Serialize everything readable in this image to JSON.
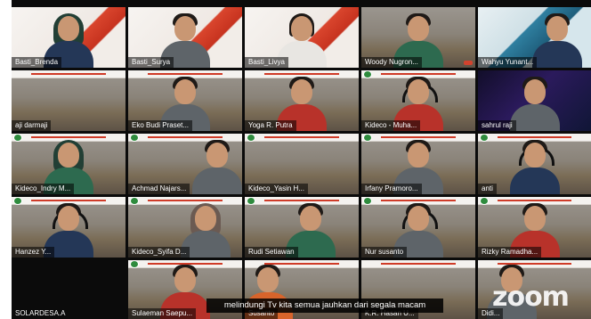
{
  "meeting": {
    "app": "zoom",
    "active_speaker": "Woody Nugron...",
    "caption": "melindungi Tv kita semua jauhkan dari segala macam"
  },
  "participants": [
    {
      "name": "Basti_Brenda",
      "bg": "red",
      "avatar": "hijab"
    },
    {
      "name": "Basti_Surya",
      "bg": "red",
      "avatar": "person"
    },
    {
      "name": "Basti_Livya",
      "bg": "red",
      "avatar": "person"
    },
    {
      "name": "Woody Nugron...",
      "bg": "quarry",
      "avatar": "person"
    },
    {
      "name": "Wahyu Yunant...",
      "bg": "blue",
      "avatar": "person"
    },
    {
      "name": "aji darmaji",
      "bg": "quarry",
      "avatar": "none"
    },
    {
      "name": "Eko Budi Praset...",
      "bg": "quarry",
      "avatar": "person"
    },
    {
      "name": "Yoga R. Putra",
      "bg": "quarry",
      "avatar": "person"
    },
    {
      "name": "Kideco - Muha...",
      "bg": "quarry",
      "avatar": "headset"
    },
    {
      "name": "sahrul raji",
      "bg": "dark",
      "avatar": "person"
    },
    {
      "name": "Kideco_Indry M...",
      "bg": "quarry",
      "avatar": "hijab"
    },
    {
      "name": "Achmad Najars...",
      "bg": "quarry",
      "avatar": "person"
    },
    {
      "name": "Kideco_Yasin H...",
      "bg": "quarry",
      "avatar": "none"
    },
    {
      "name": "Irfany Pramoro...",
      "bg": "quarry",
      "avatar": "person"
    },
    {
      "name": "anti",
      "bg": "quarry",
      "avatar": "headset"
    },
    {
      "name": "Hanzez Y...",
      "bg": "quarry",
      "avatar": "headset"
    },
    {
      "name": "Kideco_Syifa D...",
      "bg": "quarry",
      "avatar": "hijab"
    },
    {
      "name": "Rudi Setiawan",
      "bg": "quarry",
      "avatar": "person"
    },
    {
      "name": "Nur susanto",
      "bg": "quarry",
      "avatar": "headset"
    },
    {
      "name": "Rizky Ramadha...",
      "bg": "quarry",
      "avatar": "person"
    },
    {
      "name": "SOLARDESA.A",
      "bg": "none",
      "avatar": "none"
    },
    {
      "name": "Sulaeman Saepu...",
      "bg": "quarry",
      "avatar": "person"
    },
    {
      "name": "Susanto",
      "bg": "quarry",
      "avatar": "person"
    },
    {
      "name": "K.R. Hasan U...",
      "bg": "quarry",
      "avatar": "person"
    },
    {
      "name": "Didi...",
      "bg": "quarry",
      "avatar": "person"
    }
  ]
}
